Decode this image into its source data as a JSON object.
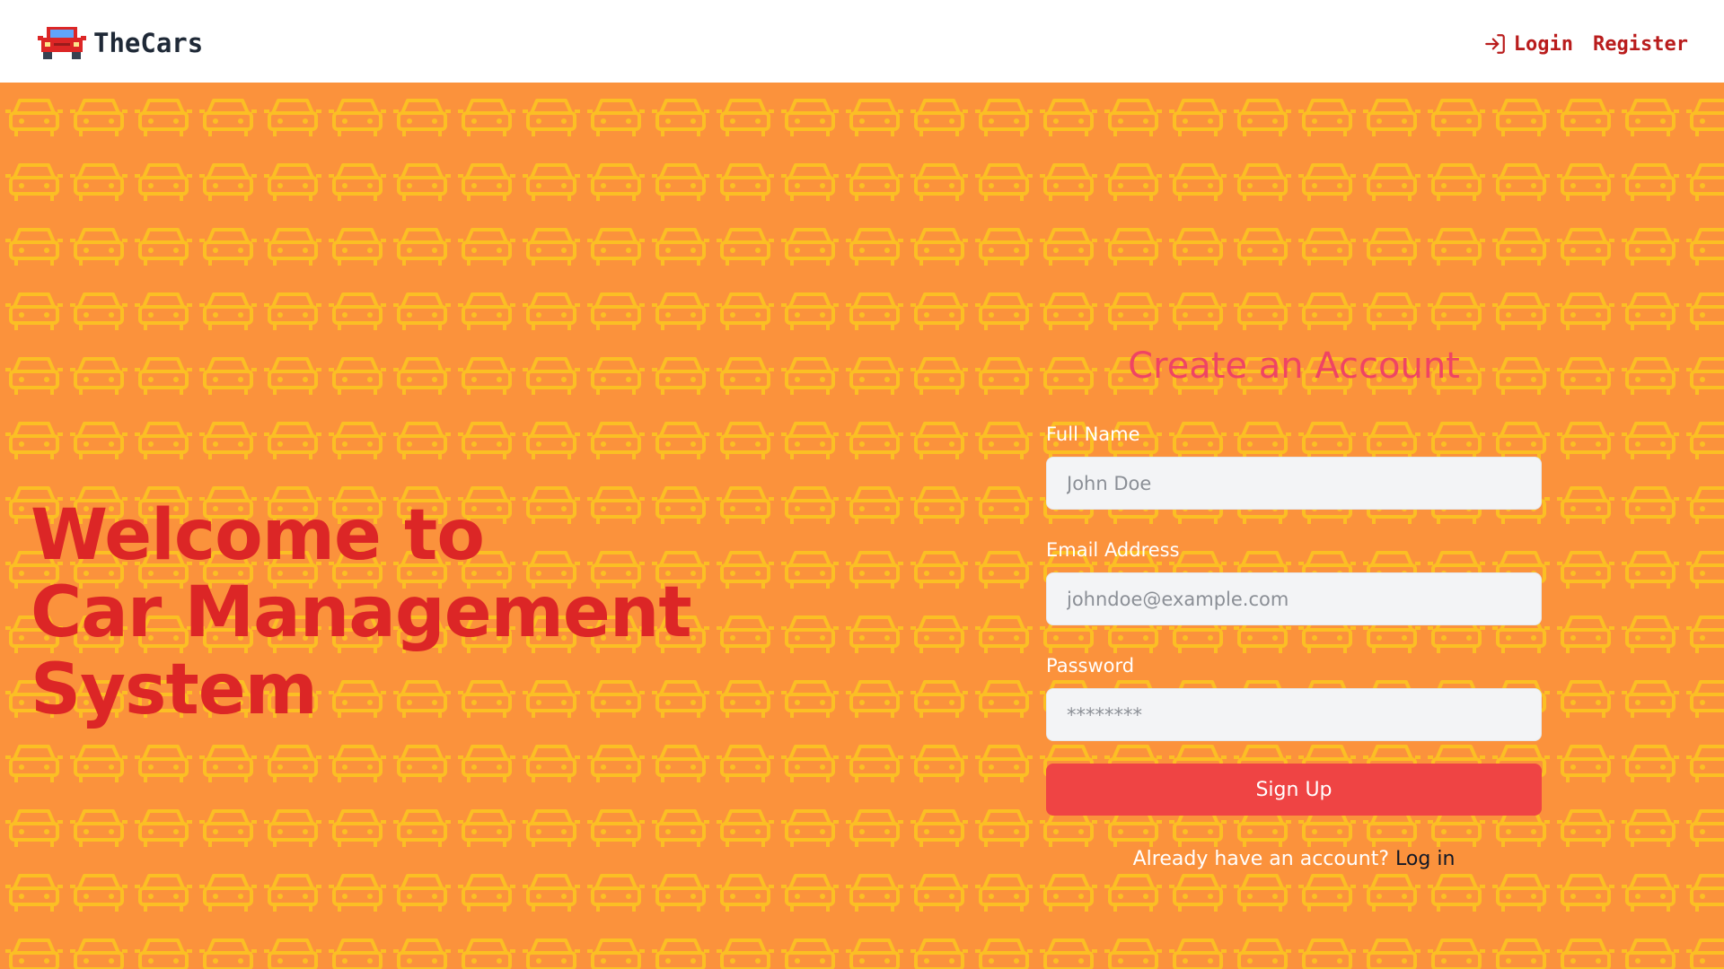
{
  "navbar": {
    "brand": "TheCars",
    "login_label": "Login",
    "register_label": "Register"
  },
  "hero": {
    "title_lines": [
      "Welcome to",
      "Car Management",
      "System"
    ]
  },
  "signup": {
    "title": "Create an Account",
    "full_name_label": "Full Name",
    "full_name_placeholder": "John Doe",
    "email_label": "Email Address",
    "email_placeholder": "johndoe@example.com",
    "password_label": "Password",
    "password_placeholder": "********",
    "submit_label": "Sign Up",
    "already_text": "Already have an account?",
    "login_link": "Log in"
  },
  "colors": {
    "background": "#fb923c",
    "pattern": "#fbbf24",
    "accent_red": "#dc2626",
    "button": "#ef4444",
    "heading_pink": "#ef4464"
  },
  "icons": {
    "brand": "car-icon",
    "login": "login-arrow-icon"
  }
}
